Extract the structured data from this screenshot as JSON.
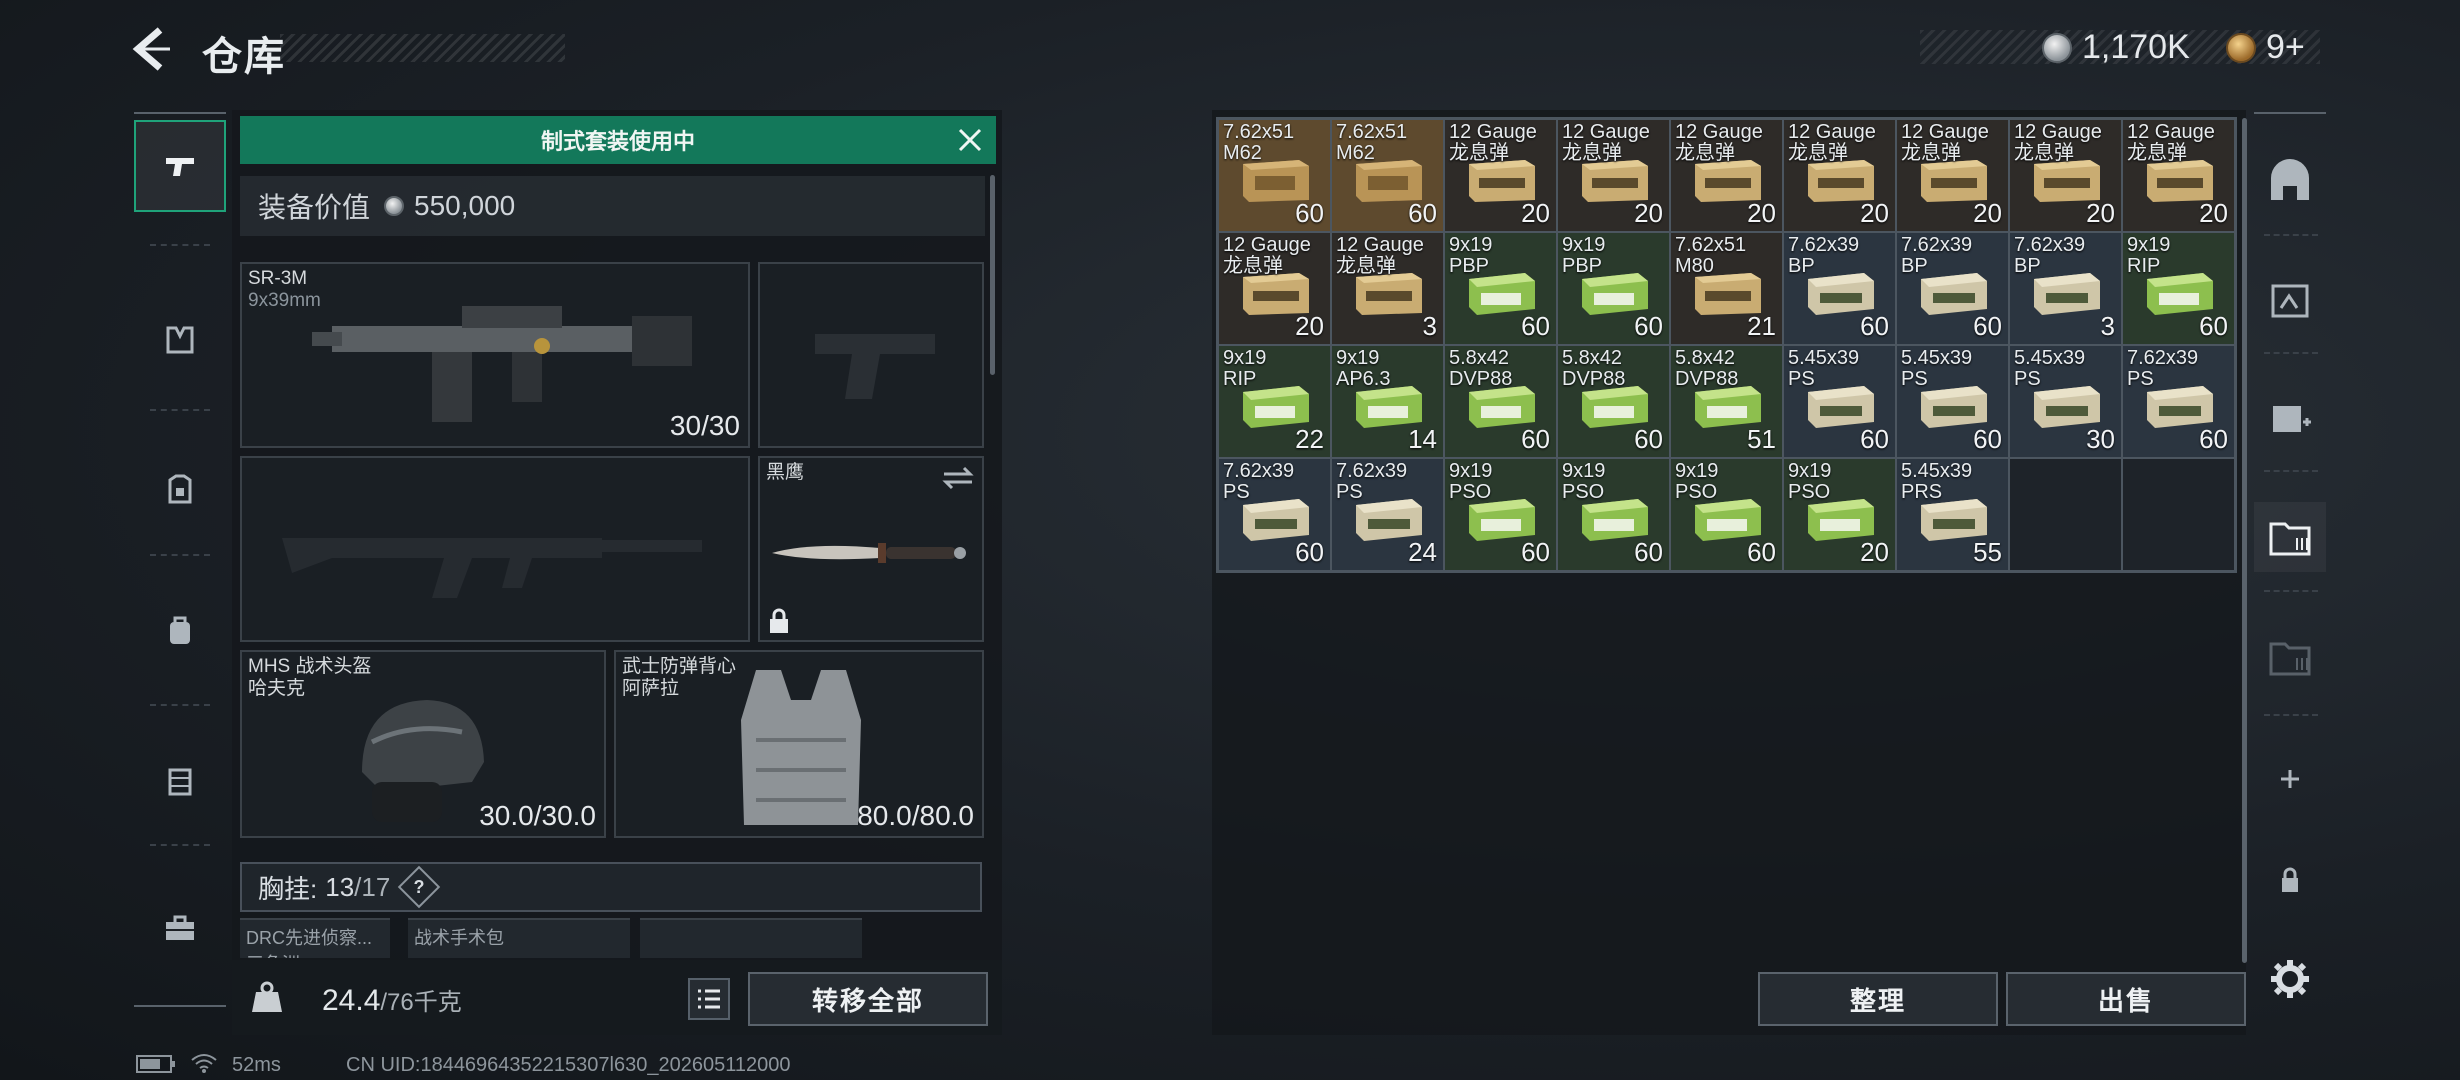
{
  "header": {
    "title": "仓库",
    "currencies": [
      {
        "name": "silver-coin",
        "value": "1,170K"
      },
      {
        "name": "gold-coin",
        "value": "9+"
      }
    ]
  },
  "loadout": {
    "banner": "制式套装使用中",
    "value_label": "装备价值",
    "value": "550,000",
    "primary": {
      "name": "SR-3M",
      "caliber": "9x39mm",
      "ammo": "30/30"
    },
    "melee": {
      "name": "黑鹰"
    },
    "helmet": {
      "name": "MHS 战术头盔",
      "variant": "哈夫克",
      "durability": "30.0/30.0"
    },
    "armor": {
      "name": "武士防弹背心",
      "variant": "阿萨拉",
      "durability": "80.0/80.0"
    },
    "rig": {
      "label": "胸挂:",
      "current": "13",
      "max": "/17",
      "help": "?"
    },
    "sub_slots": [
      {
        "line1": "DRC先进侦察...",
        "line2": "三角洲"
      },
      {
        "line1": "战术手术包",
        "line2": ""
      }
    ],
    "weight": {
      "current": "24.4",
      "max": "/76千克"
    },
    "transfer_all": "转移全部"
  },
  "stash": {
    "items": [
      {
        "l1": "7.62x51",
        "l2": "M62",
        "qty": "60",
        "kind": "m62"
      },
      {
        "l1": "7.62x51",
        "l2": "M62",
        "qty": "60",
        "kind": "m62"
      },
      {
        "l1": "12 Gauge",
        "l2": "龙息弹",
        "qty": "20",
        "kind": "gauge"
      },
      {
        "l1": "12 Gauge",
        "l2": "龙息弹",
        "qty": "20",
        "kind": "gauge"
      },
      {
        "l1": "12 Gauge",
        "l2": "龙息弹",
        "qty": "20",
        "kind": "gauge"
      },
      {
        "l1": "12 Gauge",
        "l2": "龙息弹",
        "qty": "20",
        "kind": "gauge"
      },
      {
        "l1": "12 Gauge",
        "l2": "龙息弹",
        "qty": "20",
        "kind": "gauge"
      },
      {
        "l1": "12 Gauge",
        "l2": "龙息弹",
        "qty": "20",
        "kind": "gauge"
      },
      {
        "l1": "12 Gauge",
        "l2": "龙息弹",
        "qty": "20",
        "kind": "gauge"
      },
      {
        "l1": "12 Gauge",
        "l2": "龙息弹",
        "qty": "20",
        "kind": "gauge"
      },
      {
        "l1": "12 Gauge",
        "l2": "龙息弹",
        "qty": "3",
        "kind": "gauge"
      },
      {
        "l1": "9x19",
        "l2": "PBP",
        "qty": "60",
        "kind": "green"
      },
      {
        "l1": "9x19",
        "l2": "PBP",
        "qty": "60",
        "kind": "green"
      },
      {
        "l1": "7.62x51",
        "l2": "M80",
        "qty": "21",
        "kind": "gauge"
      },
      {
        "l1": "7.62x39",
        "l2": "BP",
        "qty": "60",
        "kind": "tan"
      },
      {
        "l1": "7.62x39",
        "l2": "BP",
        "qty": "60",
        "kind": "tan"
      },
      {
        "l1": "7.62x39",
        "l2": "BP",
        "qty": "3",
        "kind": "tan"
      },
      {
        "l1": "9x19",
        "l2": "RIP",
        "qty": "60",
        "kind": "green"
      },
      {
        "l1": "9x19",
        "l2": "RIP",
        "qty": "22",
        "kind": "green"
      },
      {
        "l1": "9x19",
        "l2": "AP6.3",
        "qty": "14",
        "kind": "green"
      },
      {
        "l1": "5.8x42",
        "l2": "DVP88",
        "qty": "60",
        "kind": "green"
      },
      {
        "l1": "5.8x42",
        "l2": "DVP88",
        "qty": "60",
        "kind": "green"
      },
      {
        "l1": "5.8x42",
        "l2": "DVP88",
        "qty": "51",
        "kind": "green"
      },
      {
        "l1": "5.45x39",
        "l2": "PS",
        "qty": "60",
        "kind": "tan"
      },
      {
        "l1": "5.45x39",
        "l2": "PS",
        "qty": "60",
        "kind": "tan"
      },
      {
        "l1": "5.45x39",
        "l2": "PS",
        "qty": "30",
        "kind": "tan"
      },
      {
        "l1": "7.62x39",
        "l2": "PS",
        "qty": "60",
        "kind": "tan"
      },
      {
        "l1": "7.62x39",
        "l2": "PS",
        "qty": "60",
        "kind": "tan"
      },
      {
        "l1": "7.62x39",
        "l2": "PS",
        "qty": "24",
        "kind": "tan"
      },
      {
        "l1": "9x19",
        "l2": "PSO",
        "qty": "60",
        "kind": "green"
      },
      {
        "l1": "9x19",
        "l2": "PSO",
        "qty": "60",
        "kind": "green"
      },
      {
        "l1": "9x19",
        "l2": "PSO",
        "qty": "60",
        "kind": "green"
      },
      {
        "l1": "9x19",
        "l2": "PSO",
        "qty": "20",
        "kind": "green"
      },
      {
        "l1": "5.45x39",
        "l2": "PRS",
        "qty": "55",
        "kind": "tan"
      }
    ],
    "total_cells": 36,
    "sort_label": "整理",
    "sell_label": "出售"
  },
  "status_bar": {
    "ping": "52ms",
    "uid": "CN UID:18446964352215307l630_202605112000"
  },
  "colors": {
    "accent_green": "#13785a",
    "panel": "#1a1f24"
  }
}
